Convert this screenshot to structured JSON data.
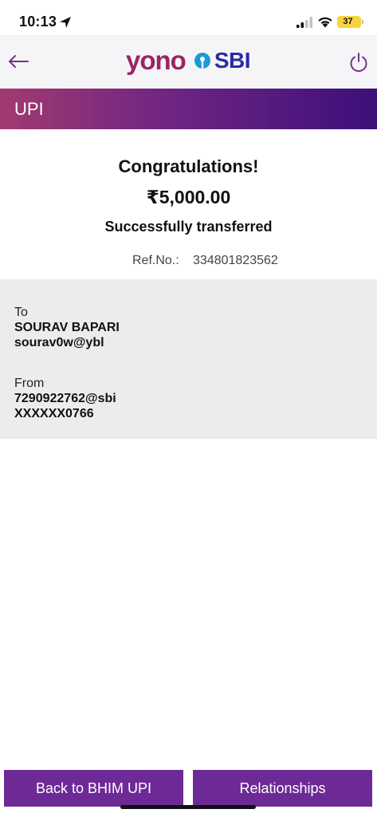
{
  "status_bar": {
    "time": "10:13",
    "battery": "37"
  },
  "header": {
    "brand_left": "yono",
    "brand_right": "SBI"
  },
  "section": {
    "title": "UPI"
  },
  "result": {
    "heading": "Congratulations!",
    "amount": "₹5,000.00",
    "message": "Successfully transferred",
    "ref_label": "Ref.No.:",
    "ref_value": "334801823562"
  },
  "details": {
    "to_label": "To",
    "to_name": "SOURAV BAPARI",
    "to_vpa": "sourav0w@ybl",
    "from_label": "From",
    "from_vpa": "7290922762@sbi",
    "from_account": "XXXXXX0766"
  },
  "actions": {
    "back_label": "Back to BHIM UPI",
    "relationships_label": "Relationships"
  },
  "colors": {
    "brand_purple": "#6d2a96",
    "yono_magenta": "#9b2466",
    "sbi_blue": "#2b2aa8",
    "battery_yellow": "#f7d33f"
  },
  "icons": [
    "location-arrow-icon",
    "cellular-signal-icon",
    "wifi-icon",
    "battery-icon",
    "back-arrow-icon",
    "sbi-keyhole-icon",
    "power-icon"
  ]
}
